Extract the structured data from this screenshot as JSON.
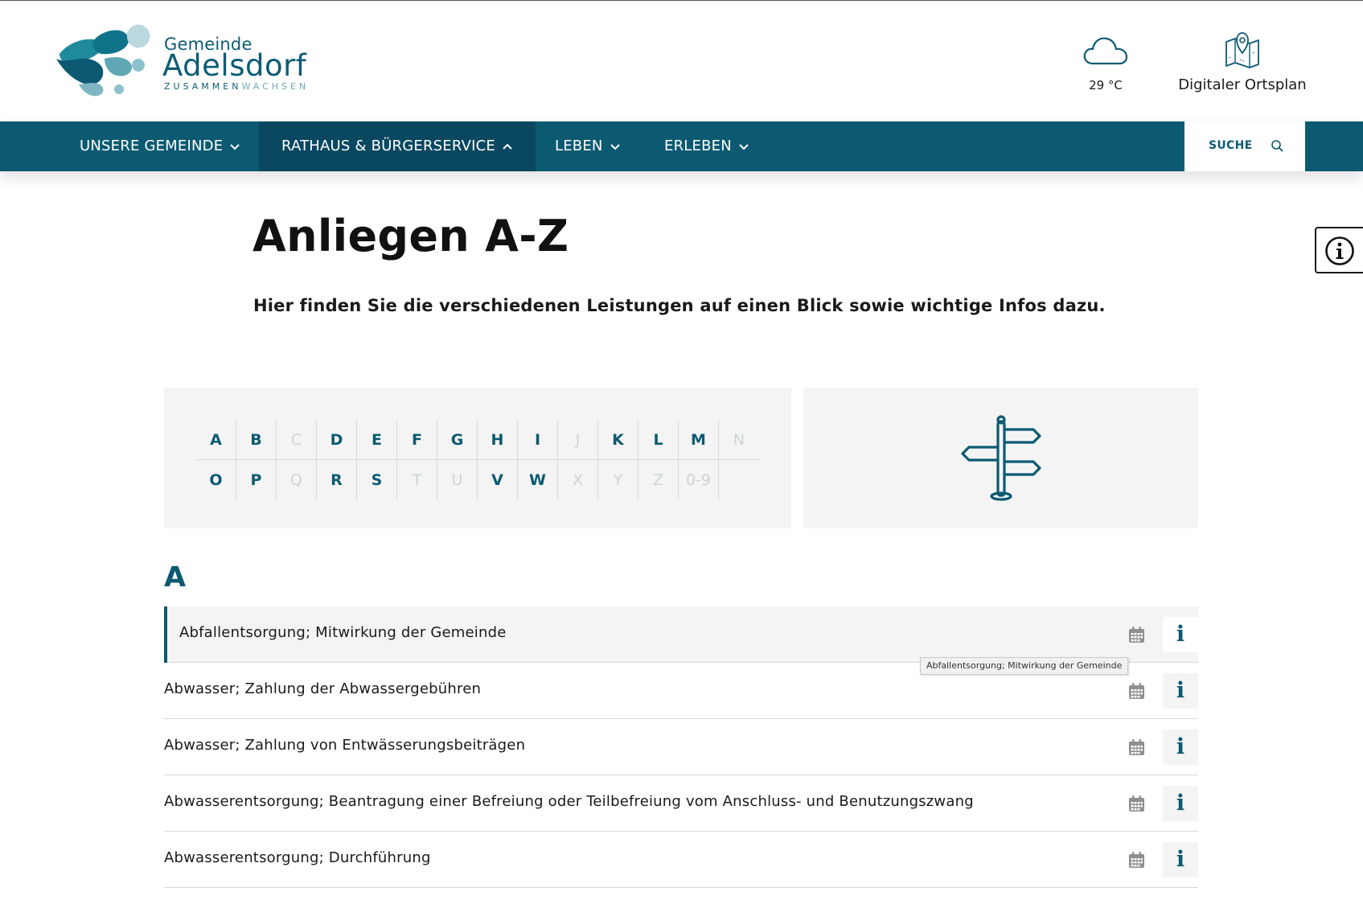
{
  "brand": {
    "name_line1": "Gemeinde",
    "name_line2": "Adelsdorf",
    "tagline_a": "ZUSAMMEN",
    "tagline_b": "WACHSEN",
    "primary_color": "#0c5a72"
  },
  "header": {
    "weather": {
      "icon": "cloud-icon",
      "temperature": "29 °C"
    },
    "map_link": {
      "icon": "map-pin-icon",
      "label": "Digitaler Ortsplan"
    }
  },
  "nav": {
    "items": [
      {
        "label": "UNSERE GEMEINDE",
        "expanded": false
      },
      {
        "label": "RATHAUS & BÜRGERSERVICE",
        "expanded": true
      },
      {
        "label": "LEBEN",
        "expanded": false
      },
      {
        "label": "ERLEBEN",
        "expanded": false
      }
    ],
    "search_label": "SUCHE"
  },
  "page": {
    "title": "Anliegen A-Z",
    "subtitle": "Hier finden Sie die verschiedenen Leistungen auf einen Blick sowie wichtige Infos dazu."
  },
  "alphabet": {
    "row1": [
      {
        "letter": "A",
        "enabled": true
      },
      {
        "letter": "B",
        "enabled": true
      },
      {
        "letter": "C",
        "enabled": false
      },
      {
        "letter": "D",
        "enabled": true
      },
      {
        "letter": "E",
        "enabled": true
      },
      {
        "letter": "F",
        "enabled": true
      },
      {
        "letter": "G",
        "enabled": true
      },
      {
        "letter": "H",
        "enabled": true
      },
      {
        "letter": "I",
        "enabled": true
      },
      {
        "letter": "J",
        "enabled": false
      },
      {
        "letter": "K",
        "enabled": true
      },
      {
        "letter": "L",
        "enabled": true
      },
      {
        "letter": "M",
        "enabled": true
      },
      {
        "letter": "N",
        "enabled": false
      }
    ],
    "row2": [
      {
        "letter": "O",
        "enabled": true
      },
      {
        "letter": "P",
        "enabled": true
      },
      {
        "letter": "Q",
        "enabled": false
      },
      {
        "letter": "R",
        "enabled": true
      },
      {
        "letter": "S",
        "enabled": true
      },
      {
        "letter": "T",
        "enabled": false
      },
      {
        "letter": "U",
        "enabled": false
      },
      {
        "letter": "V",
        "enabled": true
      },
      {
        "letter": "W",
        "enabled": true
      },
      {
        "letter": "X",
        "enabled": false
      },
      {
        "letter": "Y",
        "enabled": false
      },
      {
        "letter": "Z",
        "enabled": false
      },
      {
        "letter": "0-9",
        "enabled": false
      }
    ],
    "side_icon": "signpost-icon"
  },
  "section": {
    "letter": "A",
    "services": [
      {
        "title": "Abfallentsorgung; Mitwirkung der Gemeinde",
        "info": "i"
      },
      {
        "title": "Abwasser; Zahlung der Abwassergebühren",
        "info": "i"
      },
      {
        "title": "Abwasser; Zahlung von Entwässerungsbeiträgen",
        "info": "i"
      },
      {
        "title": "Abwasserentsorgung; Beantragung einer Befreiung oder Teilbefreiung vom Anschluss- und Benutzungszwang",
        "info": "i"
      },
      {
        "title": "Abwasserentsorgung; Durchführung",
        "info": "i"
      }
    ]
  },
  "tooltip": {
    "text": "Abfallentsorgung; Mitwirkung der Gemeinde"
  }
}
